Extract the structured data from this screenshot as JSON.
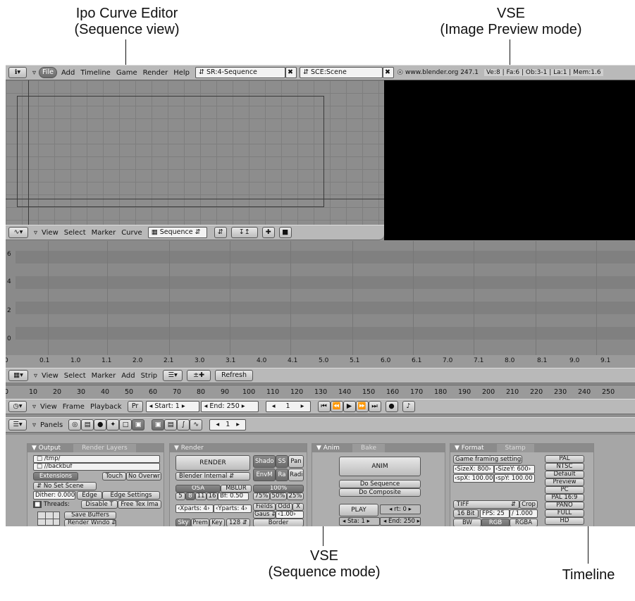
{
  "callouts": {
    "ipo": [
      "Ipo Curve Editor",
      "(Sequence view)"
    ],
    "vse_preview": [
      "VSE",
      "(Image Preview mode)"
    ],
    "vse_sequence": [
      "VSE",
      "(Sequence mode)"
    ],
    "timeline": "Timeline"
  },
  "topbar": {
    "menus": [
      "File",
      "Add",
      "Timeline",
      "Game",
      "Render",
      "Help"
    ],
    "screen": "SR:4-Sequence",
    "scene": "SCE:Scene",
    "version": "www.blender.org 247.1",
    "stats": "Ve:8 | Fa:6 | Ob:3-1 | La:1 | Mem:1.6"
  },
  "ipo_header": {
    "menus": [
      "View",
      "Select",
      "Marker",
      "Curve"
    ],
    "type": "Sequence"
  },
  "seq": {
    "y_labels": [
      "6",
      "4",
      "2",
      "0"
    ],
    "x_labels": [
      "0",
      "0.1",
      "1.0",
      "1.1",
      "2.0",
      "2.1",
      "3.0",
      "3.1",
      "4.0",
      "4.1",
      "5.0",
      "5.1",
      "6.0",
      "6.1",
      "7.0",
      "7.1",
      "8.0",
      "8.1",
      "9.0",
      "9.1"
    ],
    "menus": [
      "View",
      "Select",
      "Marker",
      "Add",
      "Strip"
    ],
    "refresh": "Refresh"
  },
  "timeline": {
    "ticks": [
      "0",
      "10",
      "20",
      "30",
      "40",
      "50",
      "60",
      "70",
      "80",
      "90",
      "100",
      "110",
      "120",
      "130",
      "140",
      "150",
      "160",
      "170",
      "180",
      "190",
      "200",
      "210",
      "220",
      "230",
      "240",
      "250"
    ],
    "menus": [
      "View",
      "Frame",
      "Playback"
    ],
    "pr": "Pr",
    "start": "Start: 1",
    "end": "End: 250",
    "current": "1"
  },
  "buttons_header": {
    "panels": "Panels",
    "frame": "1"
  },
  "output": {
    "tab_on": "Output",
    "tab_off": "Render Layers",
    "path1": "/tmp/",
    "path2": "//backbuf",
    "extensions": "Extensions",
    "touch": "Touch",
    "no_overwrite": "No Overwri",
    "no_set_scene": "No Set Scene",
    "dither": "Dither: 0.000",
    "edge": "Edge",
    "edge_settings": "Edge Settings",
    "threads": "Threads:",
    "disable_t": "Disable T",
    "free_tex": "Free Tex Ima",
    "save_buffers": "Save Buffers",
    "render_window": "Render Windo"
  },
  "render": {
    "tab": "Render",
    "render": "RENDER",
    "engine": "Blender Internal",
    "shado": "Shado",
    "ss": "SS",
    "pan": "Pan",
    "envm": "EnvM",
    "ra": "Ra",
    "radi": "Radi",
    "osa": "OSA",
    "mblur": "MBLUR",
    "pct100": "100%",
    "osa_levels": [
      "5",
      "8",
      "11",
      "16"
    ],
    "bf": "Bf: 0.50",
    "pcts": [
      "75%",
      "50%",
      "25%"
    ],
    "xparts": "Xparts: 4",
    "yparts": "Yparts: 4",
    "fields": "Fields",
    "odd": "Odd",
    "x": "X",
    "gaus": "Gaus",
    "gaus_val": "1.00",
    "sky": "Sky",
    "prem": "Prem",
    "key": "Key",
    "bits": "128",
    "border": "Border"
  },
  "anim": {
    "tab_on": "Anim",
    "tab_off": "Bake",
    "anim": "ANIM",
    "do_sequence": "Do Sequence",
    "do_composite": "Do Composite",
    "play": "PLAY",
    "rt": "rt: 0",
    "sta": "Sta: 1",
    "end": "End: 250"
  },
  "format": {
    "tab_on": "Format",
    "tab_off": "Stamp",
    "game_framing": "Game framing settings",
    "sizex": "SizeX: 800",
    "sizey": "SizeY: 600",
    "aspx": "spX: 100.00",
    "aspy": "spY: 100.00",
    "file_type": "TIFF",
    "crop": "Crop",
    "bit16": "16 Bit",
    "fps": "FPS: 25",
    "fps_div": "/ 1.000",
    "bw": "BW",
    "rgb": "RGB",
    "rgba": "RGBA",
    "presets": [
      "PAL",
      "NTSC",
      "Default",
      "Preview",
      "PC",
      "PAL 16:9",
      "PANO",
      "FULL",
      "HD"
    ]
  }
}
